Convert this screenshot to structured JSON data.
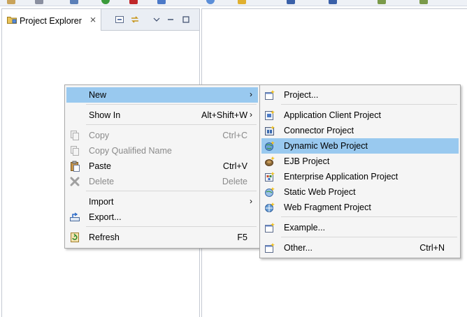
{
  "view": {
    "tab_label": "Project Explorer",
    "close_glyph": "⨯"
  },
  "context_menu": {
    "items": [
      {
        "label": "New",
        "accelerator": "",
        "submenu_arrow": "›",
        "icon": "none",
        "selected": true,
        "enabled": true
      },
      {
        "label": "Show In",
        "accelerator": "Alt+Shift+W",
        "submenu_arrow": "›",
        "icon": "none",
        "selected": false,
        "enabled": true
      },
      {
        "label": "Copy",
        "accelerator": "Ctrl+C",
        "submenu_arrow": "",
        "icon": "copy-icon",
        "selected": false,
        "enabled": false
      },
      {
        "label": "Copy Qualified Name",
        "accelerator": "",
        "submenu_arrow": "",
        "icon": "copy-qualified-name-icon",
        "selected": false,
        "enabled": false
      },
      {
        "label": "Paste",
        "accelerator": "Ctrl+V",
        "submenu_arrow": "",
        "icon": "paste-icon",
        "selected": false,
        "enabled": true
      },
      {
        "label": "Delete",
        "accelerator": "Delete",
        "submenu_arrow": "",
        "icon": "delete-icon",
        "selected": false,
        "enabled": false
      },
      {
        "label": "Import",
        "accelerator": "",
        "submenu_arrow": "›",
        "icon": "none",
        "selected": false,
        "enabled": true
      },
      {
        "label": "Export...",
        "accelerator": "",
        "submenu_arrow": "",
        "icon": "export-icon",
        "selected": false,
        "enabled": true
      },
      {
        "label": "Refresh",
        "accelerator": "F5",
        "submenu_arrow": "",
        "icon": "refresh-icon",
        "selected": false,
        "enabled": true
      }
    ]
  },
  "new_submenu": {
    "items": [
      {
        "label": "Project...",
        "accelerator": "",
        "icon": "new-project-icon",
        "selected": false
      },
      {
        "label": "Application Client Project",
        "accelerator": "",
        "icon": "application-client-project-icon",
        "selected": false
      },
      {
        "label": "Connector Project",
        "accelerator": "",
        "icon": "connector-project-icon",
        "selected": false
      },
      {
        "label": "Dynamic Web Project",
        "accelerator": "",
        "icon": "dynamic-web-project-icon",
        "selected": true
      },
      {
        "label": "EJB Project",
        "accelerator": "",
        "icon": "ejb-project-icon",
        "selected": false
      },
      {
        "label": "Enterprise Application Project",
        "accelerator": "",
        "icon": "enterprise-application-project-icon",
        "selected": false
      },
      {
        "label": "Static Web Project",
        "accelerator": "",
        "icon": "static-web-project-icon",
        "selected": false
      },
      {
        "label": "Web Fragment Project",
        "accelerator": "",
        "icon": "web-fragment-project-icon",
        "selected": false
      },
      {
        "label": "Example...",
        "accelerator": "",
        "icon": "new-example-icon",
        "selected": false
      },
      {
        "label": "Other...",
        "accelerator": "Ctrl+N",
        "icon": "new-other-icon",
        "selected": false
      }
    ]
  },
  "colors": {
    "selection": "#99c9ef",
    "menu_background": "#f5f5f5",
    "disabled_text": "#8a8a8a"
  }
}
